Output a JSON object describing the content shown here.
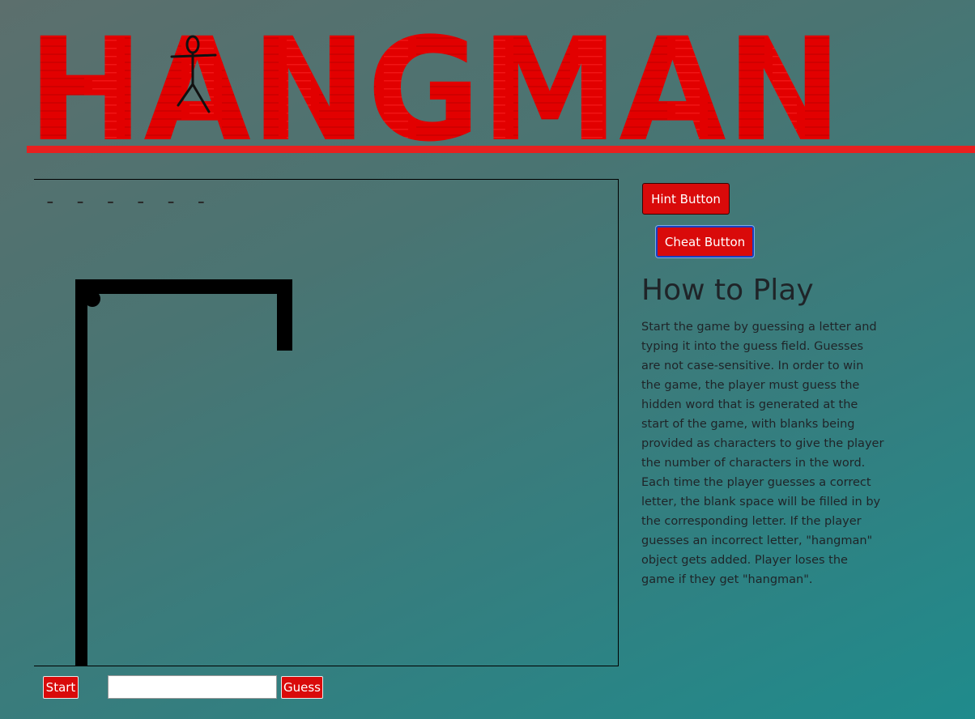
{
  "logo": {
    "text": "HANGMAN",
    "color": "#e00000",
    "bar_color": "#e8201f"
  },
  "board": {
    "word_blanks": "- - - - - -"
  },
  "controls": {
    "hint_label": "Hint Button",
    "cheat_label": "Cheat Button",
    "start_label": "Start",
    "guess_label": "Guess",
    "guess_value": "",
    "accent_color": "#d90a0a"
  },
  "how_to_play": {
    "title": "How to Play",
    "text": "Start the game by guessing a letter and typing it into the guess field. Guesses are not case-sensitive. In order to win the game, the player must guess the hidden word that is generated at the start of the game, with blanks being provided as characters to give the player the number of characters in the word. Each time the player guesses a correct letter, the blank space will be filled in by the corresponding letter. If the player guesses an incorrect letter, \"hangman\" object gets added. Player loses the game if they get \"hangman\"."
  }
}
